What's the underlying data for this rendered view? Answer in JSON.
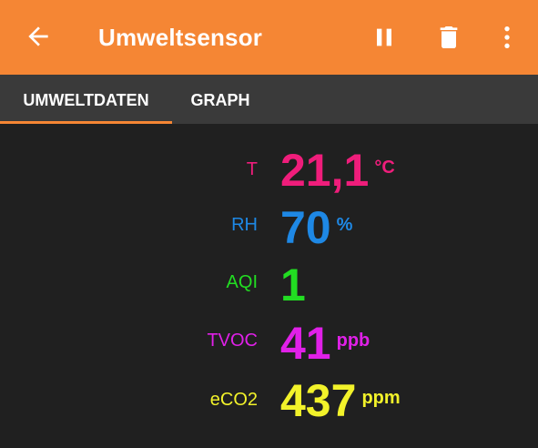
{
  "appbar": {
    "title": "Umweltsensor",
    "back_icon": "arrow-left-icon",
    "actions": [
      "pause-icon",
      "delete-icon",
      "more-vert-icon"
    ],
    "color": "#f58634"
  },
  "tabs": [
    {
      "label": "UMWELTDATEN",
      "selected": true
    },
    {
      "label": "GRAPH",
      "selected": false
    }
  ],
  "readings": [
    {
      "label": "T",
      "value": "21,1",
      "unit": "°C",
      "color": "#ef1d7b"
    },
    {
      "label": "RH",
      "value": "70",
      "unit": "%",
      "color": "#1e88e5"
    },
    {
      "label": "AQI",
      "value": "1",
      "unit": "",
      "color": "#22dd22"
    },
    {
      "label": "TVOC",
      "value": "41",
      "unit": "ppb",
      "color": "#e020e8"
    },
    {
      "label": "eCO2",
      "value": "437",
      "unit": "ppm",
      "color": "#f2f22a"
    }
  ]
}
